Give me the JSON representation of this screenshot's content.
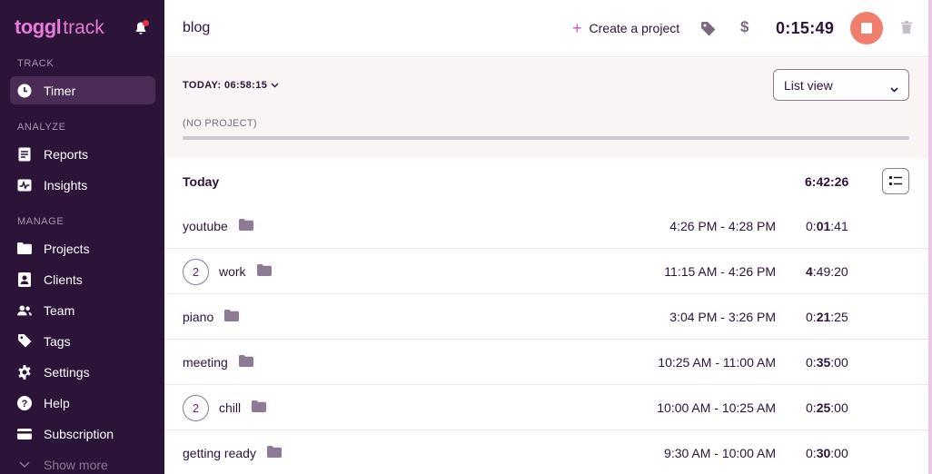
{
  "sidebar": {
    "logo_brand": "toggl",
    "logo_product": "track",
    "sections": {
      "track": "TRACK",
      "analyze": "ANALYZE",
      "manage": "MANAGE"
    },
    "items": {
      "timer": "Timer",
      "reports": "Reports",
      "insights": "Insights",
      "projects": "Projects",
      "clients": "Clients",
      "team": "Team",
      "tags": "Tags",
      "settings": "Settings",
      "help": "Help",
      "subscription": "Subscription",
      "show_more": "Show more"
    }
  },
  "topbar": {
    "entry_description": "blog",
    "create_project_label": "Create a project",
    "dollar_symbol": "$",
    "running_time": "0:15:49"
  },
  "summary": {
    "today_total": "TODAY: 06:58:15",
    "view_select_value": "List view",
    "project_label": "(NO PROJECT)"
  },
  "list": {
    "day_label": "Today",
    "day_total": "6:42:26",
    "entries": [
      {
        "count": "",
        "description": "youtube",
        "range": "4:26 PM - 4:28 PM",
        "dur_prefix": "0:",
        "dur_bold": "01",
        "dur_suffix": ":41"
      },
      {
        "count": "2",
        "description": "work",
        "range": "11:15 AM - 4:26 PM",
        "dur_prefix": "",
        "dur_bold": "4",
        "dur_suffix": ":49:20"
      },
      {
        "count": "",
        "description": "piano",
        "range": "3:04 PM - 3:26 PM",
        "dur_prefix": "0:",
        "dur_bold": "21",
        "dur_suffix": ":25"
      },
      {
        "count": "",
        "description": "meeting",
        "range": "10:25 AM - 11:00 AM",
        "dur_prefix": "0:",
        "dur_bold": "35",
        "dur_suffix": ":00"
      },
      {
        "count": "2",
        "description": "chill",
        "range": "10:00 AM - 10:25 AM",
        "dur_prefix": "0:",
        "dur_bold": "25",
        "dur_suffix": ":00"
      },
      {
        "count": "",
        "description": "getting ready",
        "range": "9:30 AM - 10:00 AM",
        "dur_prefix": "0:",
        "dur_bold": "30",
        "dur_suffix": ":00"
      }
    ]
  },
  "colors": {
    "sidebar_bg": "#2c1338",
    "brand_pink": "#e57cd8",
    "stop_button": "#f07e6c",
    "summary_bg": "#fbf4f5"
  }
}
